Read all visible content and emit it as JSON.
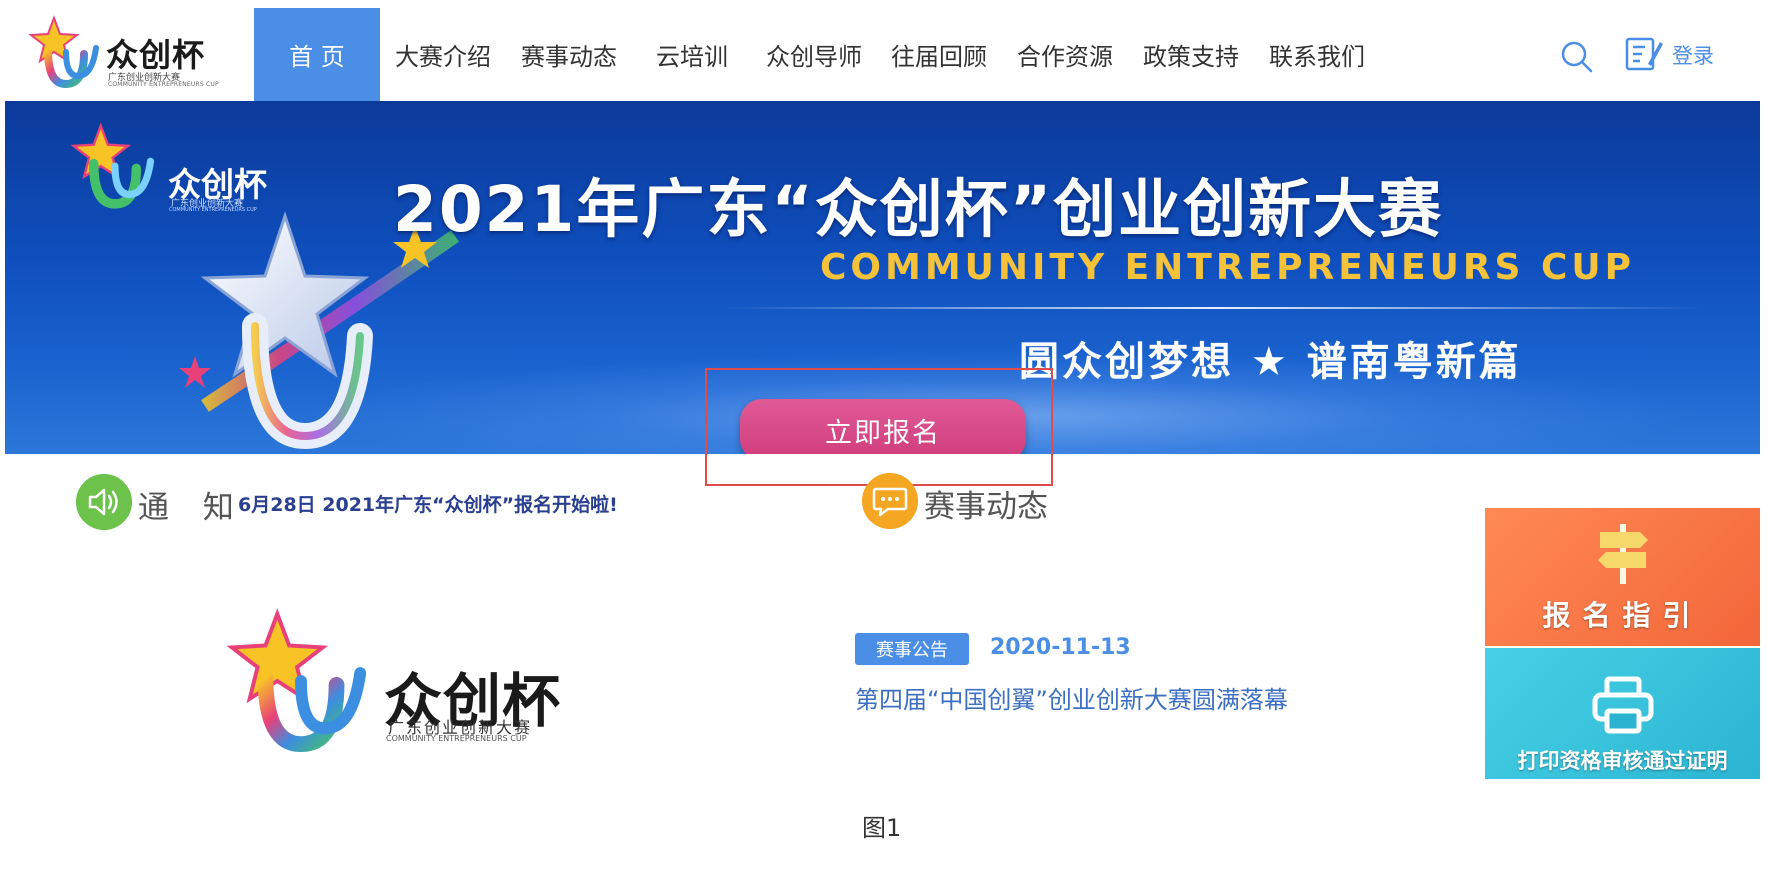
{
  "header": {
    "logo": {
      "title": "众创杯",
      "subtitle": "广东创业创新大赛",
      "subtitle_en": "COMMUNITY ENTREPRENEURS CUP"
    },
    "nav": [
      {
        "label": "首 页",
        "active": true
      },
      {
        "label": "大赛介绍"
      },
      {
        "label": "赛事动态"
      },
      {
        "label": "云培训"
      },
      {
        "label": "众创导师"
      },
      {
        "label": "往届回顾"
      },
      {
        "label": "合作资源"
      },
      {
        "label": "政策支持"
      },
      {
        "label": "联系我们"
      }
    ],
    "search_icon": "search-icon",
    "login_icon": "edit-icon",
    "login_label": "登录"
  },
  "banner": {
    "logo": {
      "title": "众创杯",
      "subtitle": "广东创业创新大赛",
      "subtitle_en": "COMMUNITY ENTREPRENEURS CUP"
    },
    "title": "2021年广东“众创杯”创业创新大赛",
    "subtitle_en": "COMMUNITY ENTREPRENEURS CUP",
    "slogan": "圆众创梦想 ★ 谱南粤新篇",
    "signup_button": "立即报名"
  },
  "notice": {
    "label": "通 知",
    "text": "6月28日 2021年广东“众创杯”报名开始啦!",
    "icon": "speaker-icon"
  },
  "news": {
    "section_label": "赛事动态",
    "icon": "chat-icon",
    "tag": "赛事公告",
    "date": "2020-11-13",
    "title": "第四届“中国创翼”创业创新大赛圆满落幕"
  },
  "big_logo": {
    "title": "众创杯",
    "subtitle": "广东创业创新大赛",
    "subtitle_en": "COMMUNITY ENTREPRENEURS CUP"
  },
  "side_cards": [
    {
      "label": "报名指引",
      "icon": "signpost-icon",
      "color": "#f2663a"
    },
    {
      "label": "打印资格审核通过证明",
      "icon": "printer-icon",
      "color": "#2bb4d2"
    }
  ],
  "caption": "图1",
  "colors": {
    "accent": "#4a8ee6",
    "signup": "#d8467f",
    "highlight_border": "#e04b4b"
  }
}
